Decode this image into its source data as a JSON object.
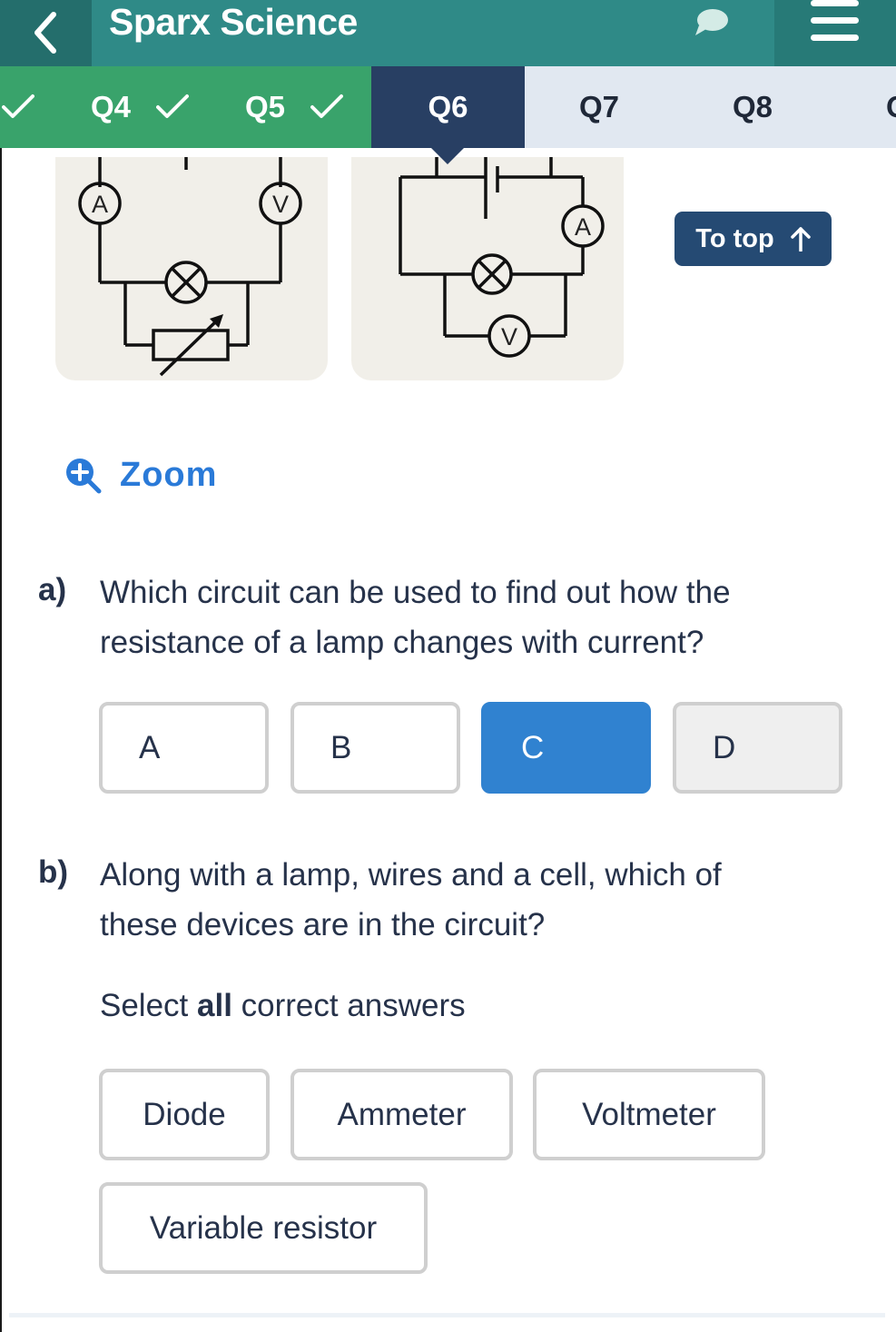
{
  "header": {
    "title": "Sparx Science",
    "back_icon": "chevron-left-icon",
    "chat_icon": "speech-bubble-icon",
    "menu_icon": "hamburger-menu-icon"
  },
  "tabs": [
    {
      "label": "",
      "status": "complete"
    },
    {
      "label": "Q4",
      "status": "complete"
    },
    {
      "label": "Q5",
      "status": "complete"
    },
    {
      "label": "Q6",
      "status": "current"
    },
    {
      "label": "Q7",
      "status": "todo"
    },
    {
      "label": "Q8",
      "status": "todo"
    },
    {
      "label": "Q",
      "status": "todo"
    }
  ],
  "diagrams": [
    {
      "label": "Circuit with ammeter, voltmeter, lamp and variable resistor",
      "meter_a": "A",
      "meter_v": "V"
    },
    {
      "label": "Circuit with cell, ammeter, lamp and voltmeter in parallel with lamp",
      "meter_a": "A",
      "meter_v": "V"
    }
  ],
  "to_top": {
    "label": "To top",
    "icon": "arrow-up-icon"
  },
  "zoom": {
    "label": "Zoom",
    "icon": "zoom-in-icon"
  },
  "question_a": {
    "part": "a)",
    "text": "Which circuit can be used to find out how the resistance of a lamp changes with current?",
    "options": [
      {
        "label": "A",
        "state": "default"
      },
      {
        "label": "B",
        "state": "default"
      },
      {
        "label": "C",
        "state": "selected"
      },
      {
        "label": "D",
        "state": "disabled"
      }
    ]
  },
  "question_b": {
    "part": "b)",
    "text": "Along with a lamp, wires and a cell, which of these devices are in the circuit?",
    "instruction_pre": "Select ",
    "instruction_bold": "all",
    "instruction_post": " correct answers",
    "options": [
      {
        "label": "Diode"
      },
      {
        "label": "Ammeter"
      },
      {
        "label": "Voltmeter"
      },
      {
        "label": "Variable resistor"
      }
    ]
  },
  "colors": {
    "header": "#2f8a87",
    "complete_tab": "#39a36b",
    "current_tab": "#283f63",
    "todo_tab": "#e1e8f1",
    "selected_option": "#3082d0",
    "link": "#2a7ad8"
  }
}
